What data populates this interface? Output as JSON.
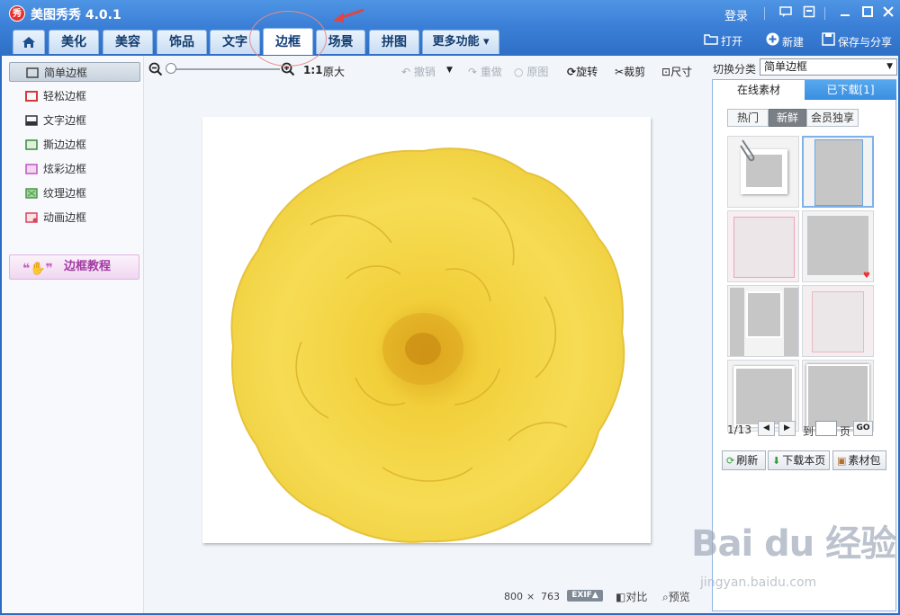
{
  "window": {
    "title": "美图秀秀 4.0.1",
    "logo_text": "秀",
    "login": "登录"
  },
  "tabs": {
    "home": "⌂",
    "items": [
      "美化",
      "美容",
      "饰品",
      "文字",
      "边框",
      "场景",
      "拼图",
      "更多功能 ▾"
    ]
  },
  "toolbar_right": {
    "open": "打开",
    "new": "新建",
    "save_share": "保存与分享"
  },
  "left_panel": {
    "items": [
      "简单边框",
      "轻松边框",
      "文字边框",
      "撕边边框",
      "炫彩边框",
      "纹理边框",
      "动画边框"
    ],
    "tutorial": "边框教程"
  },
  "edit_toolbar": {
    "ratio": "1:1",
    "original_size": "原大",
    "undo": "撤销",
    "redo": "重做",
    "original": "原图",
    "rotate": "旋转",
    "crop": "裁剪",
    "size": "尺寸"
  },
  "status": {
    "width": "800",
    "times": "×",
    "height": "763",
    "exif": "EXIF▲",
    "compare": "对比",
    "preview": "预览"
  },
  "right_panel": {
    "switch_label": "切换分类",
    "category": "简单边框",
    "tab_online": "在线素材",
    "tab_downloaded": "已下载[1]",
    "filters": [
      "热门",
      "新鲜",
      "会员独享"
    ],
    "page_indicator": "1/13",
    "goto_prefix": "到",
    "goto_suffix": "页",
    "go": "GO",
    "refresh": "刷新",
    "download_page": "下载本页",
    "material_pack": "素材包"
  },
  "watermark": {
    "brand": "Bai du 经验",
    "url": "jingyan.baidu.com"
  }
}
